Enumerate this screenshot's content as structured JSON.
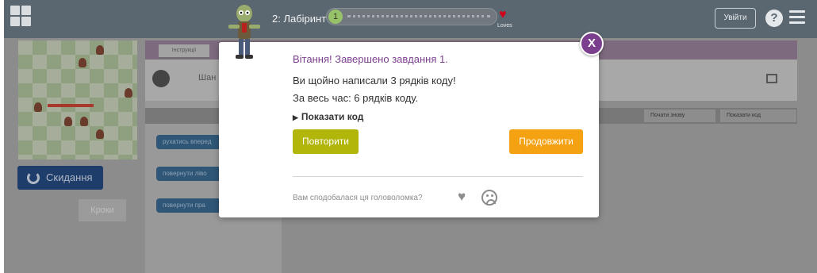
{
  "topbar": {
    "level_title": "2: Лабіринт",
    "progress_current": "1",
    "heart_caption": "Loves",
    "signin_label": "Увійти",
    "help_icon": "?"
  },
  "left_panel": {
    "reset_label": "Cкидання",
    "steps_label": "Кроки"
  },
  "instructions": {
    "tab_label": "Інструкції",
    "text": "Шан"
  },
  "workspace": {
    "undo_label": "Почати знову",
    "show_code_label": "Показати код",
    "blocks": [
      "рухатись вперед",
      "повернути ліво",
      "повернути пра"
    ]
  },
  "modal": {
    "title": "Вітання! Завершено завдання 1.",
    "line1": "Ви щойно написали 3 рядків коду!",
    "line2": "За весь час: 6 рядків коду.",
    "show_code": "Показати код",
    "retry_label": "Повторити",
    "continue_label": "Продовжити",
    "feedback_label": "Вам сподобалася ця головоломка?",
    "close_label": "X"
  },
  "colors": {
    "accent_purple": "#7b3f8e",
    "retry_green": "#b3b60a",
    "continue_orange": "#f5a212"
  }
}
